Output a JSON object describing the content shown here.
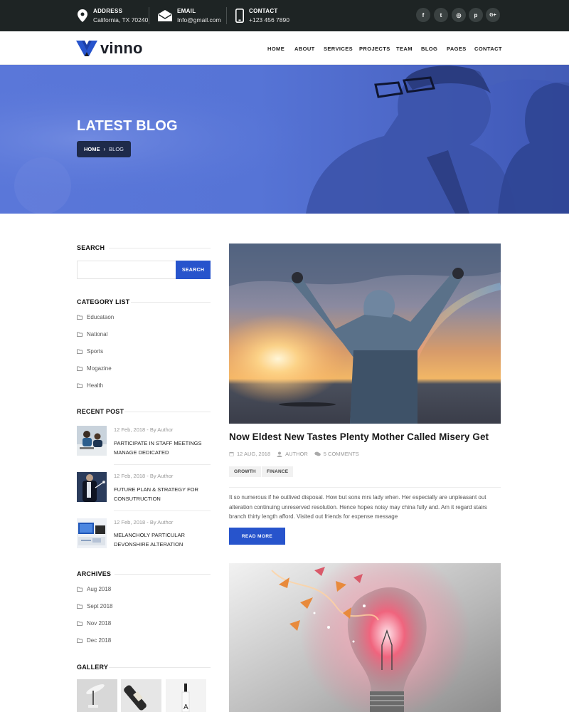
{
  "topbar": {
    "address": {
      "label": "ADDRESS",
      "value": "California, TX 70240",
      "icon": "location-pin-icon"
    },
    "email": {
      "label": "EMAIL",
      "value": "Info@gmail.com",
      "icon": "envelope-icon"
    },
    "contact": {
      "label": "CONTACT",
      "value": "+123 456 7890",
      "icon": "phone-icon"
    },
    "social": [
      {
        "glyph": "f",
        "icon": "facebook-icon"
      },
      {
        "glyph": "t",
        "icon": "twitter-icon"
      },
      {
        "glyph": "◎",
        "icon": "dribbble-icon"
      },
      {
        "glyph": "p",
        "icon": "pinterest-icon"
      },
      {
        "glyph": "G+",
        "icon": "google-plus-icon"
      }
    ]
  },
  "brand": {
    "name": "vinno",
    "accent": "#2754cc"
  },
  "nav": [
    "HOME",
    "ABOUT",
    "SERVICES",
    "PROJECTS",
    "TEAM",
    "BLOG",
    "PAGES",
    "CONTACT"
  ],
  "hero": {
    "title": "LATEST BLOG",
    "breadcrumb_home": "HOME",
    "breadcrumb_sep": "›",
    "breadcrumb_current": "BLOG"
  },
  "sidebar": {
    "search": {
      "heading": "SEARCH",
      "placeholder": "",
      "button": "SEARCH"
    },
    "categories": {
      "heading": "CATEGORY LIST",
      "items": [
        "Educataon",
        "National",
        "Sports",
        "Mogazine",
        "Health"
      ]
    },
    "recent": {
      "heading": "RECENT POST",
      "posts": [
        {
          "meta": "12 Feb, 2018 - By Author",
          "title": "PARTICIPATE IN STAFF MEETINGS MANAGE DEDICATED"
        },
        {
          "meta": "12 Feb, 2018 - By Author",
          "title": "FUTURE PLAN & STRATEGY FOR CONSUTRUCTION"
        },
        {
          "meta": "12 Feb, 2018 - By Author",
          "title": "MELANCHOLY PARTICULAR DEVONSHIRE ALTERATION"
        }
      ]
    },
    "archives": {
      "heading": "ARCHIVES",
      "items": [
        "Aug 2018",
        "Sept 2018",
        "Nov 2018",
        "Dec 2018"
      ]
    },
    "gallery": {
      "heading": "GALLERY"
    }
  },
  "post": {
    "title": "Now Eldest New Tastes Plenty Mother Called Misery Get",
    "date": "12 AUG, 2018",
    "author": "AUTHOR",
    "comments": "5 COMMENTS",
    "tags": [
      "GROWTH",
      "FINANCE"
    ],
    "excerpt": "It so numerous if he outlived disposal. How but sons mrs lady when. Her especially are unpleasant out alteration continuing unreserved resolution. Hence hopes noisy may china fully and. Am it regard stairs branch thirty length afford. Visited out friends for expense message",
    "read_more": "READ MORE"
  }
}
